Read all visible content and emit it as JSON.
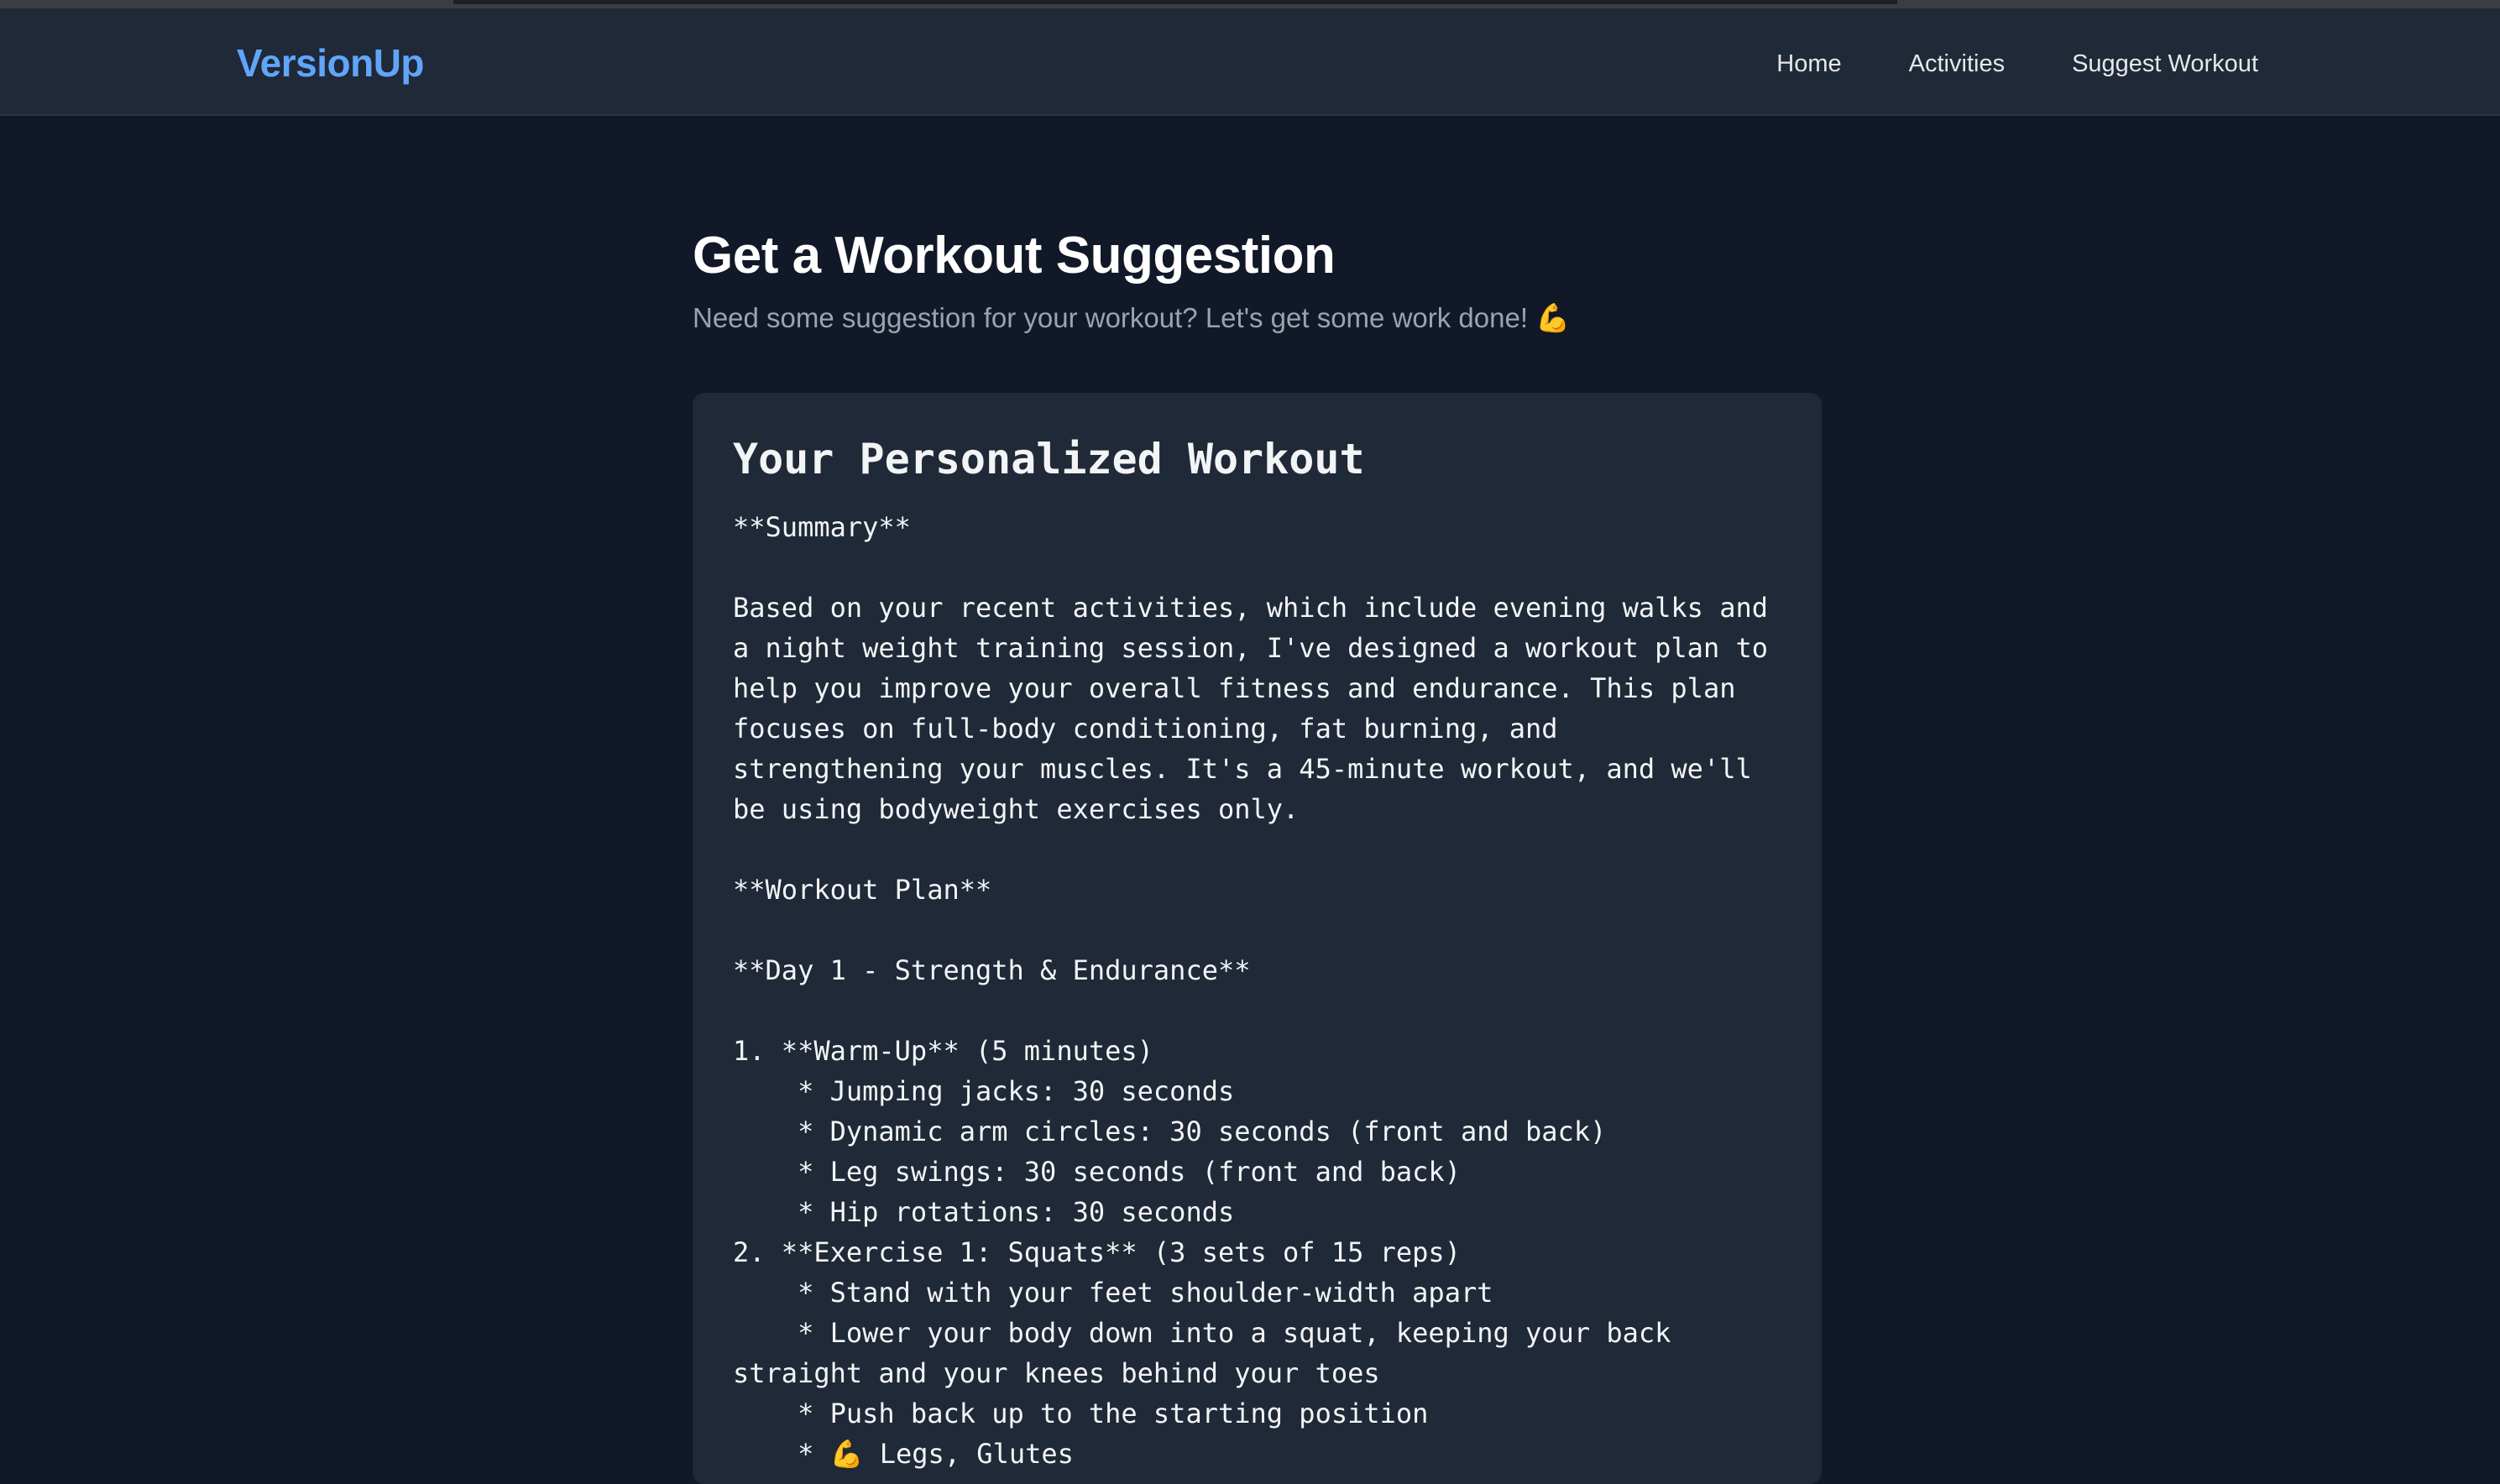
{
  "navbar": {
    "logo": "VersionUp",
    "links": [
      "Home",
      "Activities",
      "Suggest Workout"
    ]
  },
  "page": {
    "title": "Get a Workout Suggestion",
    "subtitle": "Need some suggestion for your workout? Let's get some work done! 💪"
  },
  "card": {
    "title": "Your Personalized Workout",
    "content": "**Summary**\n\nBased on your recent activities, which include evening walks and\na night weight training session, I've designed a workout plan to\nhelp you improve your overall fitness and endurance. This plan\nfocuses on full-body conditioning, fat burning, and\nstrengthening your muscles. It's a 45-minute workout, and we'll\nbe using bodyweight exercises only.\n\n**Workout Plan**\n\n**Day 1 - Strength & Endurance**\n\n1. **Warm-Up** (5 minutes)\n    * Jumping jacks: 30 seconds\n    * Dynamic arm circles: 30 seconds (front and back)\n    * Leg swings: 30 seconds (front and back)\n    * Hip rotations: 30 seconds\n2. **Exercise 1: Squats** (3 sets of 15 reps)\n    * Stand with your feet shoulder-width apart\n    * Lower your body down into a squat, keeping your back\nstraight and your knees behind your toes\n    * Push back up to the starting position\n    * 💪 Legs, Glutes"
  },
  "colors": {
    "background": "#111827",
    "navbar": "#1f2937",
    "card": "#1f2937",
    "accent": "#60a5fa",
    "muted_text": "#9ca3af"
  }
}
